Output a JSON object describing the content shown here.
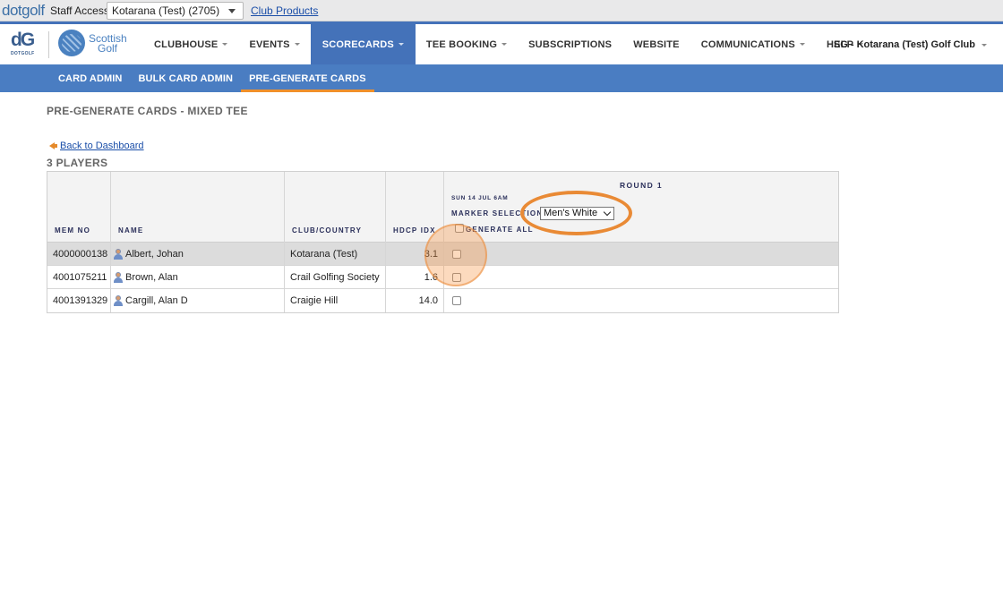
{
  "staffbar": {
    "logo_text": "dotgolf",
    "staff_label": "Staff Access",
    "club_select_value": "Kotarana (Test) (2705)",
    "club_products_link": "Club Products"
  },
  "mainnav": {
    "dotgolf_mark": "dG",
    "dotgolf_caption": "DOTGOLF",
    "scottish_golf_line1": "Scottish",
    "scottish_golf_line2": "Golf",
    "items": [
      {
        "label": "CLUBHOUSE",
        "dropdown": true
      },
      {
        "label": "EVENTS",
        "dropdown": true
      },
      {
        "label": "SCORECARDS",
        "dropdown": true,
        "active": true
      },
      {
        "label": "TEE BOOKING",
        "dropdown": true
      },
      {
        "label": "SUBSCRIPTIONS",
        "dropdown": false
      },
      {
        "label": "WEBSITE",
        "dropdown": false
      },
      {
        "label": "COMMUNICATIONS",
        "dropdown": true
      },
      {
        "label": "HELP",
        "dropdown": true
      }
    ],
    "club_name": "SG - Kotarana (Test) Golf Club"
  },
  "subnav": {
    "items": [
      {
        "label": "CARD ADMIN",
        "active": false
      },
      {
        "label": "BULK CARD ADMIN",
        "active": false
      },
      {
        "label": "PRE-GENERATE CARDS",
        "active": true
      }
    ]
  },
  "page": {
    "title": "PRE-GENERATE CARDS - MIXED TEE",
    "back_link": "Back to Dashboard",
    "players_count": "3 PLAYERS"
  },
  "table": {
    "headers": {
      "mem_no": "MEM NO",
      "name": "NAME",
      "club_country": "CLUB/COUNTRY",
      "hdcp_idx": "HDCP IDX",
      "round": "ROUND 1",
      "round_date": "SUN 14 JUL 6AM",
      "marker_label": "MARKER SELECTION:",
      "marker_value": "Men's White",
      "generate_all": "GENERATE ALL"
    },
    "rows": [
      {
        "mem_no": "4000000138",
        "name": "Albert, Johan",
        "club": "Kotarana (Test)",
        "hdcp": "3.1",
        "highlighted": true
      },
      {
        "mem_no": "4001075211",
        "name": "Brown, Alan",
        "club": "Crail Golfing Society",
        "hdcp": "1.6",
        "highlighted": false
      },
      {
        "mem_no": "4001391329",
        "name": "Cargill, Alan D",
        "club": "Craigie Hill",
        "hdcp": "14.0",
        "highlighted": false
      }
    ]
  },
  "colors": {
    "nav_blue": "#4472b9",
    "subnav_blue": "#4a7dc2",
    "accent_orange": "#f0902a",
    "link_blue": "#1a4ea8",
    "row_highlight": "#dcdcdc"
  }
}
